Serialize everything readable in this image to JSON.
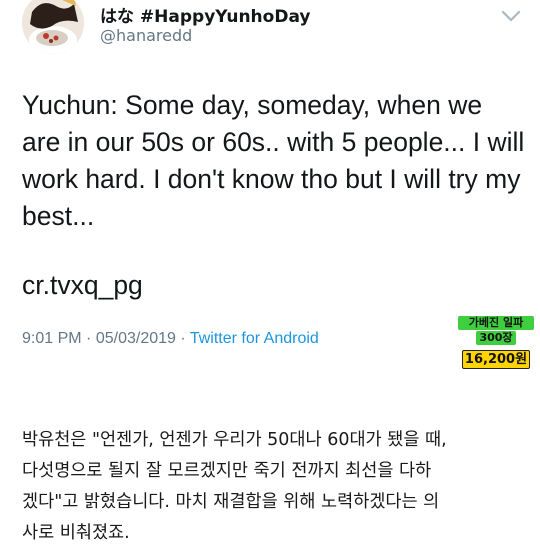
{
  "tweet": {
    "display_name": "はな #HappyYunhoDay",
    "handle": "@hanaredd",
    "text_lines": [
      "Yuchun: Some day, someday, when we",
      "are in our 50s or 60s.. with 5 people... I will",
      "work hard. I don't know tho but I will try my",
      "best..."
    ],
    "credit": "cr.tvxq_pg",
    "time": "9:01 PM",
    "date": "05/03/2019",
    "separator": "·",
    "source": "Twitter for Android",
    "menu_icon": "chevron-down-icon"
  },
  "promo": {
    "line1": "가베진 일파",
    "line2": "300장",
    "price": "16,200원"
  },
  "caption": {
    "lines": [
      "박유천은 \"언젠가, 언젠가 우리가 50대나 60대가 됐을 때,",
      "다섯명으로 될지 잘 모르겠지만 죽기 전까지 최선을 다하",
      "겠다\"고 밝혔습니다. 마치 재결합을 위해 노력하겠다는 의",
      "사로 비춰졌죠."
    ]
  },
  "colors": {
    "text": "#14171a",
    "secondary": "#657786",
    "link": "#1b95e0",
    "promo_green": "#3fce3f",
    "promo_yellow": "#ffd400"
  }
}
